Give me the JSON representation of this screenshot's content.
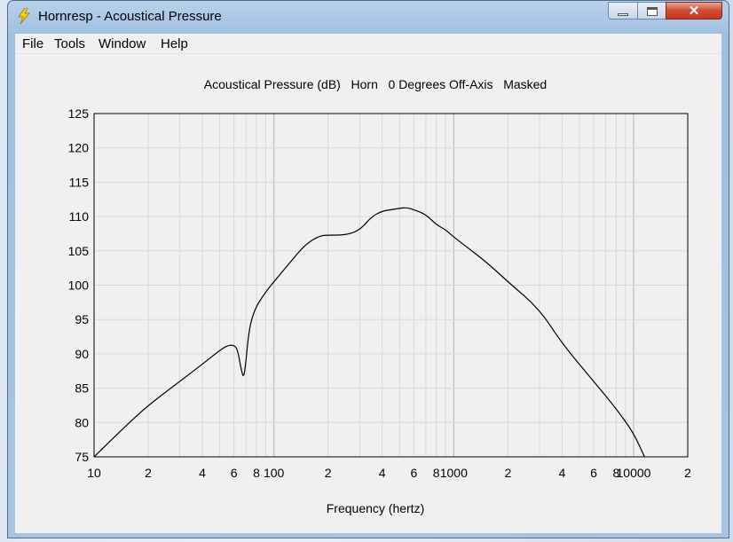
{
  "window": {
    "title": "Hornresp - Acoustical Pressure",
    "close_glyph": "✕"
  },
  "menu": [
    "File",
    "Tools",
    "Window",
    "Help"
  ],
  "icons": {
    "app": "lightning-bolt-icon"
  },
  "colors": {
    "accent_close": "#c7391f",
    "window_frame": "#a6c3e3",
    "plot_line": "#000000"
  },
  "chart_data": {
    "type": "line",
    "title": "Acoustical Pressure (dB)   Horn   0 Degrees Off-Axis   Masked",
    "xlabel": "Frequency (hertz)",
    "ylabel": "",
    "x_scale": "log",
    "xlim": [
      10,
      20000
    ],
    "ylim": [
      75,
      125
    ],
    "grid": true,
    "y_ticks": [
      "125",
      "120",
      "115",
      "110",
      "105",
      "100",
      "95",
      "90",
      "85",
      "80",
      "75"
    ],
    "x_ticks": [
      {
        "v": 10,
        "label": "10"
      },
      {
        "v": 20,
        "label": "2"
      },
      {
        "v": 40,
        "label": "4"
      },
      {
        "v": 60,
        "label": "6"
      },
      {
        "v": 80,
        "label": "8"
      },
      {
        "v": 100,
        "label": "100"
      },
      {
        "v": 200,
        "label": "2"
      },
      {
        "v": 400,
        "label": "4"
      },
      {
        "v": 600,
        "label": "6"
      },
      {
        "v": 800,
        "label": "8"
      },
      {
        "v": 1000,
        "label": "1000"
      },
      {
        "v": 2000,
        "label": "2"
      },
      {
        "v": 4000,
        "label": "4"
      },
      {
        "v": 6000,
        "label": "6"
      },
      {
        "v": 8000,
        "label": "8"
      },
      {
        "v": 10000,
        "label": "10000"
      },
      {
        "v": 20000,
        "label": "2"
      }
    ],
    "series": [
      {
        "x": [
          10,
          15,
          20,
          30,
          40,
          50,
          55,
          60,
          63,
          66,
          68,
          70,
          72,
          75,
          80,
          90,
          100,
          120,
          150,
          180,
          200,
          250,
          300,
          350,
          400,
          450,
          500,
          550,
          600,
          700,
          800,
          900,
          1000,
          1500,
          2000,
          3000,
          4000,
          6000,
          8000,
          10000,
          11500
        ],
        "y": [
          75,
          79.5,
          82.5,
          86,
          88.5,
          90.5,
          91.2,
          91.3,
          90.5,
          87.5,
          86.5,
          89,
          92.5,
          95,
          97,
          99,
          100.5,
          103,
          106,
          107.2,
          107.3,
          107.3,
          108,
          110,
          110.8,
          111,
          111.2,
          111.3,
          111,
          110.3,
          108.8,
          108.1,
          107,
          103.5,
          100.5,
          96.5,
          91.5,
          86,
          82,
          78.5,
          75
        ]
      }
    ]
  }
}
